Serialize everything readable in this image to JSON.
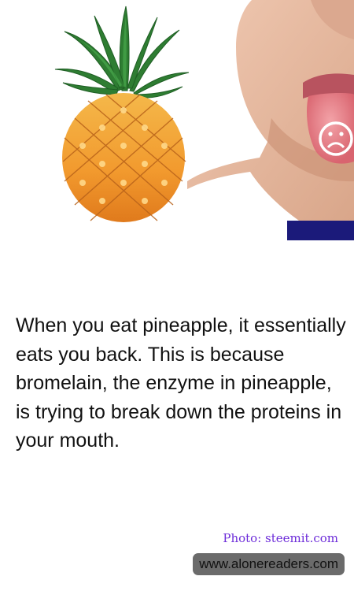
{
  "image": {
    "subject": "pineapple-and-tongue",
    "colors": {
      "accent_bar": "#1b1a7a",
      "pineapple_body": "#f2a93b",
      "pineapple_leaves": "#2e7d32",
      "tongue": "#e9828c",
      "skin": "#e8bda3"
    }
  },
  "article": {
    "text": "When you eat pineapple, it essentially eats you back. This is because bromelain, the enzyme in pineapple, is trying to break down the proteins in your mouth."
  },
  "credit": {
    "text": "Photo: steemit.com",
    "color": "#6c2bd9"
  },
  "watermark": {
    "text": "www.alonereaders.com"
  }
}
